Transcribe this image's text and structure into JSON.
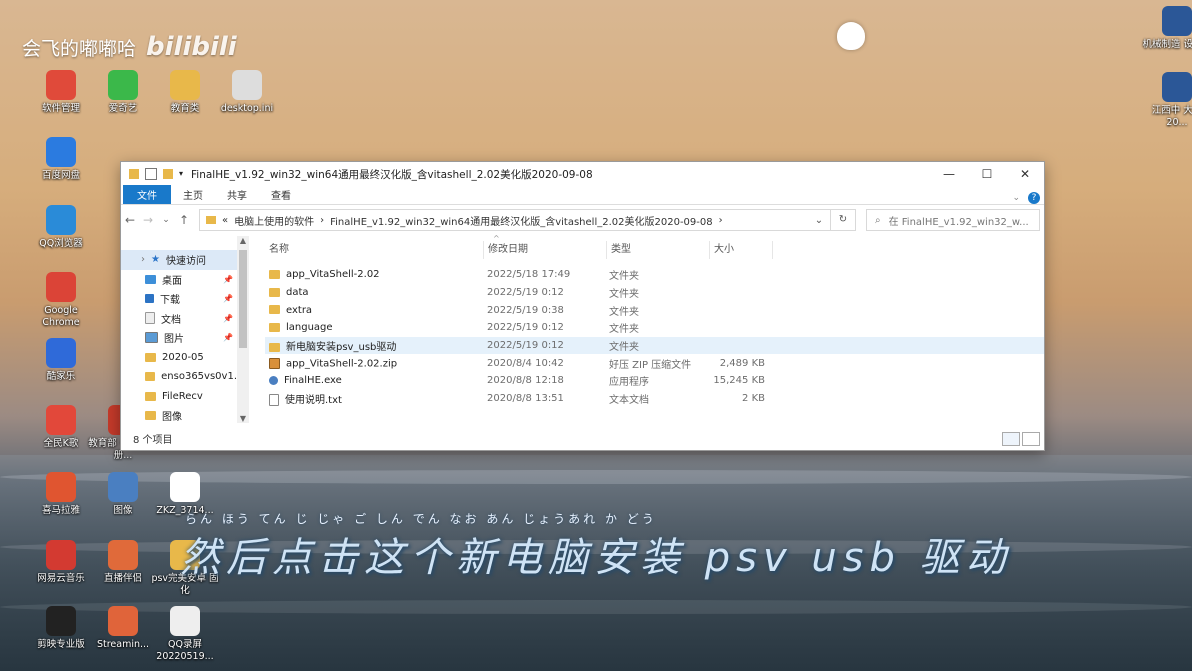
{
  "watermark": {
    "user": "会飞的嘟嘟哈",
    "site": "bilibili"
  },
  "desktop_icons": [
    {
      "label": "软件管理",
      "color": "#e04a3a"
    },
    {
      "label": "爱奇艺",
      "color": "#3bb84a"
    },
    {
      "label": "教育类",
      "color": "#e8b84a"
    },
    {
      "label": "desktop.ini",
      "color": "#dddddd"
    },
    {
      "label": "百度网盘",
      "color": "#2b7be0"
    },
    {
      "label": "QQ浏览器",
      "color": "#2a8bd8"
    },
    {
      "label": "Google Chrome",
      "color": "#db4437"
    },
    {
      "label": "酷家乐",
      "color": "#2f6ad9"
    },
    {
      "label": "全民K歌",
      "color": "#e2483a"
    },
    {
      "label": "教育部 书电子注册...",
      "color": "#c43a2a"
    },
    {
      "label": "喜马拉雅",
      "color": "#e05530"
    },
    {
      "label": "图像",
      "color": "#4a7fc1"
    },
    {
      "label": "ZKZ_3714...",
      "color": "#ffffff"
    },
    {
      "label": "网易云音乐",
      "color": "#d33a31"
    },
    {
      "label": "直播伴侣",
      "color": "#e06a3a"
    },
    {
      "label": "psv完美安卓 固化",
      "color": "#e8b84a"
    },
    {
      "label": "剪映专业版",
      "color": "#222222"
    },
    {
      "label": "Streamin...",
      "color": "#e0643a"
    },
    {
      "label": "QQ录屏 20220519...",
      "color": "#eeeeee"
    },
    {
      "label": "机械制造 设计...",
      "color": "#2b5797"
    },
    {
      "label": "江西中 大学20...",
      "color": "#2b5797"
    }
  ],
  "window": {
    "title": "FinalHE_v1.92_win32_win64通用最终汉化版_含vitashell_2.02美化版2020-09-08",
    "controls": {
      "minimize": "—",
      "maximize": "☐",
      "close": "✕"
    },
    "ribbon_tabs": [
      "文件",
      "主页",
      "共享",
      "查看"
    ],
    "address": {
      "prefix": "«",
      "parts": [
        "电脑上使用的软件",
        "FinalHE_v1.92_win32_win64通用最终汉化版_含vitashell_2.02美化版2020-09-08"
      ],
      "sep": "›"
    },
    "search_placeholder": "在 FinalHE_v1.92_win32_w...",
    "nav": [
      {
        "label": "快速访问",
        "icon": "star-icon",
        "pinned": false
      },
      {
        "label": "桌面",
        "icon": "desktop-icon",
        "pinned": true
      },
      {
        "label": "下载",
        "icon": "download-icon",
        "pinned": true
      },
      {
        "label": "文档",
        "icon": "document-icon",
        "pinned": true
      },
      {
        "label": "图片",
        "icon": "picture-icon",
        "pinned": true
      },
      {
        "label": "2020-05",
        "icon": "folder-icon",
        "pinned": false
      },
      {
        "label": "enso365vs0v1.",
        "icon": "folder-icon",
        "pinned": false
      },
      {
        "label": "FileRecv",
        "icon": "folder-icon",
        "pinned": false
      },
      {
        "label": "图像",
        "icon": "folder-icon",
        "pinned": false
      }
    ],
    "status": "8 个项目",
    "columns": {
      "name": "名称",
      "date": "修改日期",
      "type": "类型",
      "size": "大小"
    },
    "files": [
      {
        "name": "app_VitaShell-2.02",
        "date": "2022/5/18 17:49",
        "type": "文件夹",
        "size": "",
        "kind": "folder"
      },
      {
        "name": "data",
        "date": "2022/5/19 0:12",
        "type": "文件夹",
        "size": "",
        "kind": "folder"
      },
      {
        "name": "extra",
        "date": "2022/5/19 0:38",
        "type": "文件夹",
        "size": "",
        "kind": "folder"
      },
      {
        "name": "language",
        "date": "2022/5/19 0:12",
        "type": "文件夹",
        "size": "",
        "kind": "folder"
      },
      {
        "name": "新电脑安装psv_usb驱动",
        "date": "2022/5/19 0:12",
        "type": "文件夹",
        "size": "",
        "kind": "folder"
      },
      {
        "name": "app_VitaShell-2.02.zip",
        "date": "2020/8/4 10:42",
        "type": "好压 ZIP 压缩文件",
        "size": "2,489 KB",
        "kind": "zip"
      },
      {
        "name": "FinalHE.exe",
        "date": "2020/8/8 12:18",
        "type": "应用程序",
        "size": "15,245 KB",
        "kind": "exe"
      },
      {
        "name": "使用说明.txt",
        "date": "2020/8/8 13:51",
        "type": "文本文档",
        "size": "2 KB",
        "kind": "txt"
      }
    ]
  },
  "subtitle": {
    "text": "然后点击这个新电脑安装 psv usb 驱动",
    "ruby": "らん  ほう  てん   じ    じゃ   ご    しん   でん  なお  あん じょうあれ                    か   どう"
  }
}
